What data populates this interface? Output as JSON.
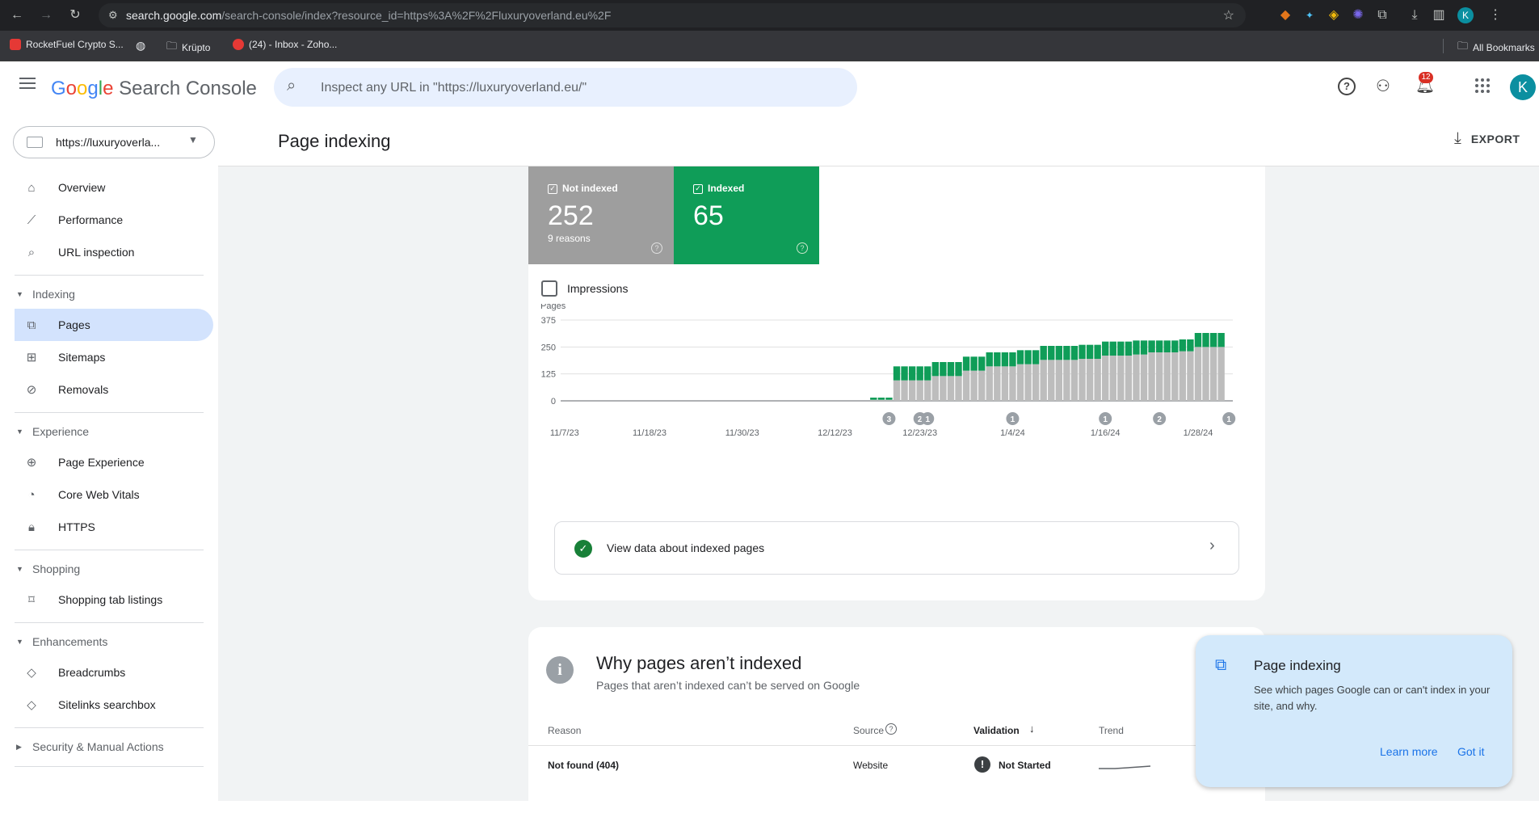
{
  "browser": {
    "url_host": "search.google.com",
    "url_path": "/search-console/index?resource_id=https%3A%2F%2Fluxuryoverland.eu%2F",
    "profile_initial": "K",
    "bookmarks": [
      "RocketFuel Crypto S...",
      "Krüpto",
      "(24) - Inbox - Zoho..."
    ],
    "all_bookmarks": "All Bookmarks"
  },
  "app": {
    "logo_google": "Google",
    "logo_product": "Search Console",
    "search_placeholder": "Inspect any URL in \"https://luxuryoverland.eu/\"",
    "notification_count": "12",
    "avatar_initial": "K",
    "property": "https://luxuryoverla...",
    "page_title": "Page indexing",
    "export_label": "EXPORT"
  },
  "sidebar": {
    "top_items": [
      {
        "label": "Overview",
        "icon": "home-icon"
      },
      {
        "label": "Performance",
        "icon": "trending-up-icon"
      },
      {
        "label": "URL inspection",
        "icon": "search-icon"
      }
    ],
    "sections": [
      {
        "title": "Indexing",
        "items": [
          {
            "label": "Pages",
            "icon": "pages-icon",
            "active": true
          },
          {
            "label": "Sitemaps",
            "icon": "sitemap-icon"
          },
          {
            "label": "Removals",
            "icon": "eye-off-icon"
          }
        ]
      },
      {
        "title": "Experience",
        "items": [
          {
            "label": "Page Experience",
            "icon": "add-circle-icon"
          },
          {
            "label": "Core Web Vitals",
            "icon": "gauge-icon"
          },
          {
            "label": "HTTPS",
            "icon": "lock-icon"
          }
        ]
      },
      {
        "title": "Shopping",
        "items": [
          {
            "label": "Shopping tab listings",
            "icon": "tag-icon"
          }
        ]
      },
      {
        "title": "Enhancements",
        "items": [
          {
            "label": "Breadcrumbs",
            "icon": "layers-icon"
          },
          {
            "label": "Sitelinks searchbox",
            "icon": "layers-icon"
          }
        ]
      }
    ],
    "collapsed_section": "Security & Manual Actions"
  },
  "summary": {
    "not_indexed_label": "Not indexed",
    "not_indexed_value": "252",
    "not_indexed_sub": "9 reasons",
    "indexed_label": "Indexed",
    "indexed_value": "65",
    "impressions_label": "Impressions",
    "colors": {
      "not_indexed": "#9e9e9e",
      "indexed": "#0f9d58"
    }
  },
  "chart_data": {
    "type": "bar",
    "stacked": true,
    "ylabel": "Pages",
    "ylim": [
      0,
      375
    ],
    "yticks": [
      0,
      125,
      250,
      375
    ],
    "xtick_labels": [
      "11/7/23",
      "11/18/23",
      "11/30/23",
      "12/12/23",
      "12/23/23",
      "1/4/24",
      "1/16/24",
      "1/28/24"
    ],
    "x_start": "2023-11-07",
    "x_end": "2024-02-02",
    "series": [
      {
        "name": "Not indexed",
        "color": "#bdbdbd",
        "start": "2023-12-17",
        "values": [
          5,
          5,
          5,
          95,
          95,
          95,
          95,
          95,
          115,
          115,
          115,
          115,
          140,
          140,
          140,
          160,
          160,
          160,
          160,
          170,
          170,
          170,
          190,
          190,
          190,
          190,
          190,
          195,
          195,
          195,
          210,
          210,
          210,
          210,
          215,
          215,
          225,
          225,
          225,
          225,
          230,
          230,
          250,
          250,
          250,
          250
        ]
      },
      {
        "name": "Indexed",
        "color": "#0f9d58",
        "start": "2023-12-17",
        "values": [
          10,
          10,
          10,
          65,
          65,
          65,
          65,
          65,
          65,
          65,
          65,
          65,
          65,
          65,
          65,
          65,
          65,
          65,
          65,
          65,
          65,
          65,
          65,
          65,
          65,
          65,
          65,
          65,
          65,
          65,
          65,
          65,
          65,
          65,
          65,
          65,
          55,
          55,
          55,
          55,
          55,
          55,
          65,
          65,
          65,
          65
        ]
      }
    ],
    "annotations": [
      {
        "date": "2023-12-19",
        "label": "3"
      },
      {
        "date": "2023-12-23",
        "label": "2"
      },
      {
        "date": "2023-12-24",
        "label": "1"
      },
      {
        "date": "2024-01-04",
        "label": "1"
      },
      {
        "date": "2024-01-16",
        "label": "1"
      },
      {
        "date": "2024-01-23",
        "label": "2"
      },
      {
        "date": "2024-02-01",
        "label": "1"
      }
    ]
  },
  "view_data_label": "View data about indexed pages",
  "why": {
    "title": "Why pages aren’t indexed",
    "subtitle": "Pages that aren’t indexed can’t be served on Google",
    "headers": {
      "reason": "Reason",
      "source": "Source",
      "validation": "Validation",
      "trend": "Trend"
    },
    "rows": [
      {
        "reason": "Not found (404)",
        "source": "Website",
        "validation": "Not Started"
      }
    ]
  },
  "popup": {
    "title": "Page indexing",
    "body": "See which pages Google can or can't index in your site, and why.",
    "learn_more": "Learn more",
    "got_it": "Got it"
  }
}
